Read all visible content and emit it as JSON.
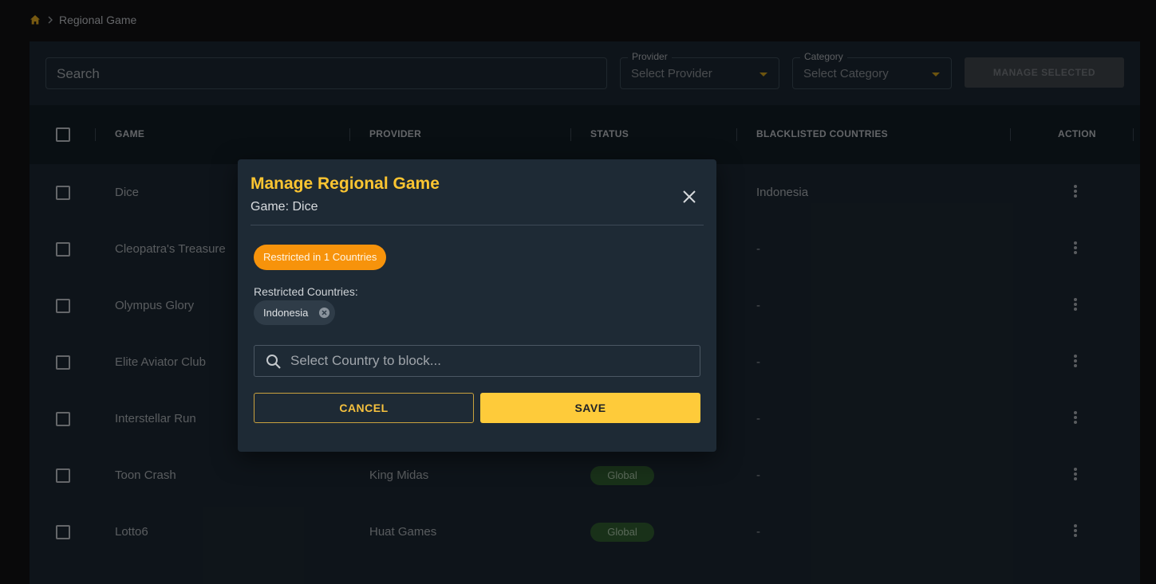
{
  "breadcrumb": {
    "current": "Regional Game"
  },
  "filters": {
    "search_placeholder": "Search",
    "provider": {
      "label": "Provider",
      "value": "Select Provider"
    },
    "category": {
      "label": "Category",
      "value": "Select Category"
    },
    "manage_selected_label": "MANAGE SELECTED"
  },
  "table": {
    "headers": [
      "GAME",
      "PROVIDER",
      "STATUS",
      "BLACKLISTED COUNTRIES",
      "ACTION"
    ],
    "rows": [
      {
        "game": "Dice",
        "provider": "",
        "status": "",
        "blacklisted": "Indonesia"
      },
      {
        "game": "Cleopatra's Treasure",
        "provider": "",
        "status": "",
        "blacklisted": "-"
      },
      {
        "game": "Olympus Glory",
        "provider": "",
        "status": "",
        "blacklisted": "-"
      },
      {
        "game": "Elite Aviator Club",
        "provider": "",
        "status": "",
        "blacklisted": "-"
      },
      {
        "game": "Interstellar Run",
        "provider": "",
        "status": "",
        "blacklisted": "-"
      },
      {
        "game": "Toon Crash",
        "provider": "King Midas",
        "status": "Global",
        "blacklisted": "-"
      },
      {
        "game": "Lotto6",
        "provider": "Huat Games",
        "status": "Global",
        "blacklisted": "-"
      }
    ]
  },
  "modal": {
    "title": "Manage Regional Game",
    "subtitle": "Game: Dice",
    "restricted_badge": "Restricted in 1 Countries",
    "restricted_label": "Restricted Countries:",
    "countries": [
      "Indonesia"
    ],
    "country_placeholder": "Select Country to block...",
    "cancel_label": "CANCEL",
    "save_label": "SAVE"
  },
  "colors": {
    "accent": "#fcc531",
    "badge_orange": "#f7930b",
    "status_global": "#2f5a2e",
    "background": "#111213",
    "panel": "#1b2630"
  },
  "icons": [
    "home-icon",
    "chevron-right-icon",
    "caret-down-icon",
    "kebab-menu-icon",
    "close-icon",
    "chip-remove-icon",
    "search-icon"
  ]
}
